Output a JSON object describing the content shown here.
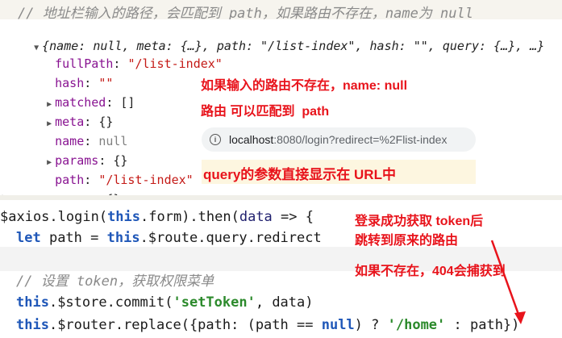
{
  "top_comment": "// 地址栏输入的路径，会匹配到 path，如果路由不存在，name为 null",
  "console": {
    "summary_open": "{name: null, meta: {…}, path: \"/list-index\", hash: \"\", query: {…}, …}",
    "props": [
      {
        "expandable": false,
        "key": "fullPath",
        "value": "\"/list-index\"",
        "kind": "str"
      },
      {
        "expandable": false,
        "key": "hash",
        "value": "\"\"",
        "kind": "str"
      },
      {
        "expandable": true,
        "key": "matched",
        "value": "[]",
        "kind": "obj"
      },
      {
        "expandable": true,
        "key": "meta",
        "value": "{}",
        "kind": "obj"
      },
      {
        "expandable": false,
        "key": "name",
        "value": "null",
        "kind": "nul"
      },
      {
        "expandable": true,
        "key": "params",
        "value": "{}",
        "kind": "obj"
      },
      {
        "expandable": false,
        "key": "path",
        "value": "\"/list-index\"",
        "kind": "str"
      },
      {
        "expandable": true,
        "key": "query",
        "value": "{}",
        "kind": "obj"
      }
    ]
  },
  "annotations": {
    "note1": "如果输入的路由不存在，name: null",
    "note2": "路由 可以匹配到  path",
    "note3": "query的参数直接显示在 URL中",
    "note4_line1": "登录成功获取 token后",
    "note4_line2": "跳转到原来的路由",
    "note5": "如果不存在，404会捕获到"
  },
  "address_bar": {
    "host": "localhost",
    "rest": ":8080/login?redirect=%2Flist-index",
    "icon": "info-icon"
  },
  "code": {
    "l1_a": "$axios.login(",
    "l1_b": "this",
    "l1_c": ".form).then(",
    "l1_d": "data",
    "l1_e": " => {",
    "l2_a": "let",
    "l2_b": " path = ",
    "l2_c": "this",
    "l2_d": ".$route.query.redirect",
    "l4": "// 设置 token，获取权限菜单",
    "l5_a": "this",
    "l5_b": ".$store.commit(",
    "l5_c": "'setToken'",
    "l5_d": ", data)",
    "l6_a": "this",
    "l6_b": ".$router.replace({path: (path == ",
    "l6_c": "null",
    "l6_d": ") ? ",
    "l6_e": "'/home'",
    "l6_f": " : path})"
  },
  "colors": {
    "annotation_red": "#e8131b",
    "keyword_blue": "#1f57b8",
    "string_green": "#2c8a2c",
    "console_key_purple": "#881391",
    "console_string_red": "#c41a16"
  }
}
